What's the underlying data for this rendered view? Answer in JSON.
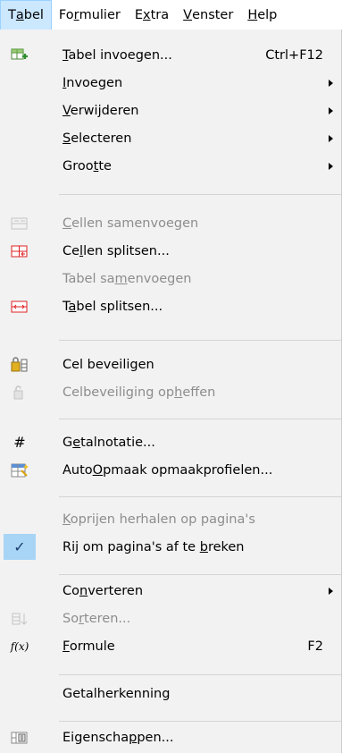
{
  "menubar": {
    "items": [
      {
        "pre": "T",
        "ul": "a",
        "post": "bel"
      },
      {
        "pre": "Fo",
        "ul": "r",
        "post": "mulier"
      },
      {
        "pre": "E",
        "ul": "x",
        "post": "tra"
      },
      {
        "pre": "",
        "ul": "V",
        "post": "enster"
      },
      {
        "pre": "",
        "ul": "H",
        "post": "elp"
      }
    ]
  },
  "menu": {
    "items": [
      {
        "pre": "",
        "ul": "T",
        "post": "abel invoegen...",
        "shortcut": "Ctrl+F12",
        "icon": "insert-table-icon"
      },
      {
        "pre": "",
        "ul": "I",
        "post": "nvoegen",
        "submenu": true
      },
      {
        "pre": "",
        "ul": "V",
        "post": "erwijderen",
        "submenu": true
      },
      {
        "pre": "",
        "ul": "S",
        "post": "electeren",
        "submenu": true
      },
      {
        "pre": "Groo",
        "ul": "t",
        "post": "te",
        "submenu": true
      },
      {
        "pre": "",
        "ul": "C",
        "post": "ellen samenvoegen",
        "disabled": true,
        "icon": "merge-cells-icon"
      },
      {
        "pre": "Ce",
        "ul": "l",
        "post": "len splitsen...",
        "icon": "split-cells-icon"
      },
      {
        "pre": "Tabel sa",
        "ul": "m",
        "post": "envoegen",
        "disabled": true
      },
      {
        "pre": "T",
        "ul": "a",
        "post": "bel splitsen...",
        "icon": "split-table-icon"
      },
      {
        "pre": "Cel beveili",
        "ul": "g",
        "post": "en",
        "icon": "protect-cell-icon"
      },
      {
        "pre": "Celbeveiliging op",
        "ul": "h",
        "post": "effen",
        "disabled": true,
        "icon": "unprotect-cell-icon"
      },
      {
        "pre": "G",
        "ul": "e",
        "post": "talnotatie...",
        "icon": "number-format-icon",
        "glyph": "#"
      },
      {
        "pre": "Auto",
        "ul": "O",
        "post": "pmaak opmaakprofielen...",
        "icon": "autoformat-icon"
      },
      {
        "pre": "",
        "ul": "K",
        "post": "oprijen herhalen op pagina's",
        "disabled": true
      },
      {
        "pre": "Rij om pagina's af te ",
        "ul": "b",
        "post": "reken",
        "checked": true,
        "icon": "checkmark-icon",
        "glyph": "✓"
      },
      {
        "pre": "Co",
        "ul": "n",
        "post": "verteren",
        "submenu": true
      },
      {
        "pre": "So",
        "ul": "r",
        "post": "teren...",
        "disabled": true,
        "icon": "sort-icon"
      },
      {
        "pre": "",
        "ul": "F",
        "post": "ormule",
        "shortcut": "F2",
        "icon": "formula-icon",
        "glyph": "f(x)"
      },
      {
        "pre": "Getalherkenning",
        "ul": "",
        "post": ""
      },
      {
        "pre": "Eigenscha",
        "ul": "p",
        "post": "pen...",
        "icon": "properties-icon"
      }
    ]
  }
}
